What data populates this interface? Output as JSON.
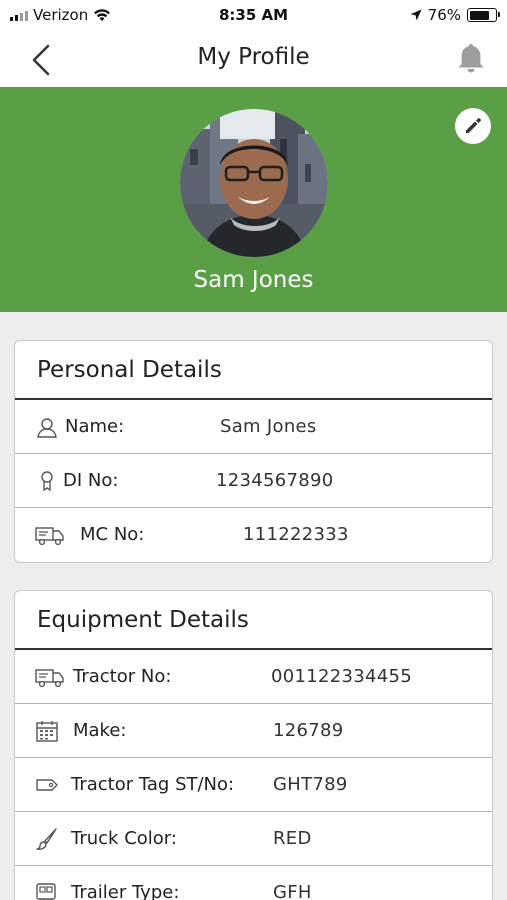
{
  "status_bar": {
    "carrier": "Verizon",
    "time": "8:35 AM",
    "battery": "76%",
    "battery_level": 0.76
  },
  "nav": {
    "title": "My Profile",
    "back_icon": "chevron-left-icon",
    "bell_icon": "bell-icon"
  },
  "profile": {
    "name": "Sam Jones",
    "accent_color": "#5a9f46",
    "edit_icon": "pencil-icon"
  },
  "personal": {
    "title": "Personal Details",
    "rows": [
      {
        "label": "Name:",
        "value": "Sam Jones",
        "icon": "user-icon"
      },
      {
        "label": "DI No:",
        "value": "1234567890",
        "icon": "badge-icon"
      },
      {
        "label": "MC No:",
        "value": "111222333",
        "icon": "truck-icon"
      }
    ]
  },
  "equipment": {
    "title": "Equipment Details",
    "rows": [
      {
        "label": "Tractor No:",
        "value": "001122334455",
        "icon": "truck-icon"
      },
      {
        "label": "Make:",
        "value": "126789",
        "icon": "calendar-icon"
      },
      {
        "label": "Tractor Tag ST/No:",
        "value": "GHT789",
        "icon": "tag-icon"
      },
      {
        "label": "Truck Color:",
        "value": "RED",
        "icon": "paintbrush-icon"
      },
      {
        "label": "Trailer Type:",
        "value": "GFH",
        "icon": "trailer-icon"
      }
    ]
  }
}
